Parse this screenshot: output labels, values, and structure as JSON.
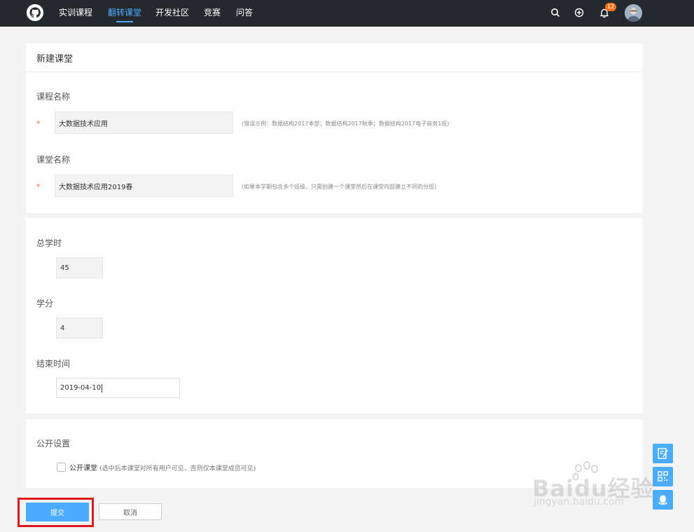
{
  "nav": {
    "items": [
      {
        "label": "实训课程",
        "active": false
      },
      {
        "label": "翻转课堂",
        "active": true
      },
      {
        "label": "开发社区",
        "active": false
      },
      {
        "label": "竞赛",
        "active": false
      },
      {
        "label": "问答",
        "active": false
      }
    ],
    "notification_count": "12"
  },
  "form": {
    "title": "新建课堂",
    "course_name": {
      "label": "课程名称",
      "required_mark": "*",
      "value": "大数据技术应用",
      "hint": "(错误示例：数据结构2017本部；数据结构2017秋季；数据结构2017电子商务1班)"
    },
    "class_name": {
      "label": "课堂名称",
      "required_mark": "*",
      "value": "大数据技术应用2019春",
      "hint": "(如果本学期包含多个班级，只需创建一个课堂然后在课堂内部建立不同的分班)"
    },
    "total_hours": {
      "label": "总学时",
      "value": "45"
    },
    "credit": {
      "label": "学分",
      "value": "4"
    },
    "end_time": {
      "label": "结束时间",
      "value": "2019-04-10"
    },
    "public": {
      "section_label": "公开设置",
      "checkbox_label": "公开课堂",
      "checkbox_desc": "(选中后本课堂对所有用户可见，否则仅本课堂成员可见)",
      "checked": false
    },
    "submit_label": "提交",
    "cancel_label": "取消"
  },
  "watermark": {
    "line1": "Baidu经验",
    "line2": "jingyan.baidu.com"
  },
  "colors": {
    "accent": "#4cacff",
    "nav_bg": "#24292d",
    "required": "#ff6a3c",
    "highlight": "#e0171d",
    "badge": "#ff6f1e"
  }
}
